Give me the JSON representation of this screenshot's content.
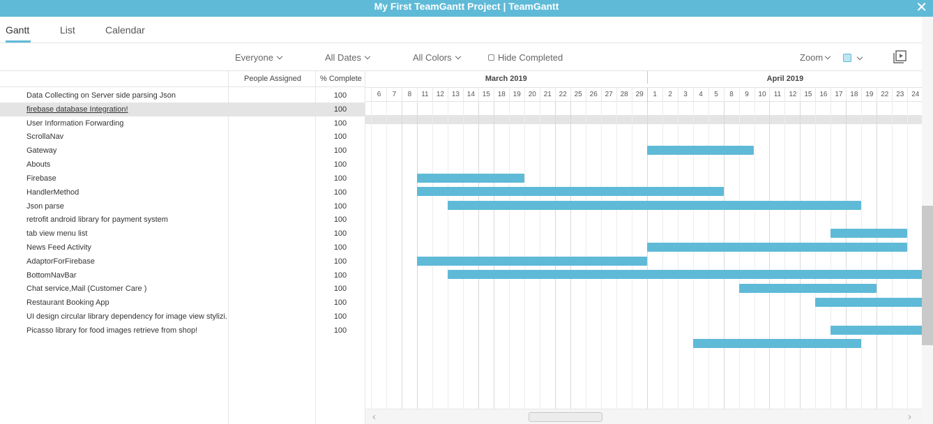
{
  "window": {
    "title": "My First TeamGantt Project | TeamGantt"
  },
  "tabs": [
    {
      "label": "Gantt"
    },
    {
      "label": "List"
    },
    {
      "label": "Calendar"
    }
  ],
  "filters": {
    "people": "Everyone",
    "dates": "All Dates",
    "colors": "All Colors",
    "hide_completed": "Hide Completed",
    "zoom": "Zoom"
  },
  "columns": {
    "assigned": "People Assigned",
    "complete": "% Complete"
  },
  "months": [
    "March 2019",
    "April 2019"
  ],
  "days": [
    "6",
    "7",
    "8",
    "11",
    "12",
    "13",
    "14",
    "15",
    "18",
    "19",
    "20",
    "21",
    "22",
    "25",
    "26",
    "27",
    "28",
    "29",
    "1",
    "2",
    "3",
    "4",
    "5",
    "8",
    "9",
    "10",
    "11",
    "12",
    "15",
    "16",
    "17",
    "18",
    "19",
    "22",
    "23",
    "24"
  ],
  "tasks": [
    {
      "name": "Data Collecting on Server side parsing Json",
      "pct": "100"
    },
    {
      "name": "firebase database Integration!",
      "pct": "100"
    },
    {
      "name": "User Information Forwarding",
      "pct": "100"
    },
    {
      "name": "ScrollaNav",
      "pct": "100"
    },
    {
      "name": "Gateway",
      "pct": "100"
    },
    {
      "name": "Abouts",
      "pct": "100"
    },
    {
      "name": "Firebase",
      "pct": "100"
    },
    {
      "name": "HandlerMethod",
      "pct": "100"
    },
    {
      "name": "Json parse",
      "pct": "100"
    },
    {
      "name": "retrofit android library for payment system",
      "pct": "100"
    },
    {
      "name": "tab view menu list",
      "pct": "100"
    },
    {
      "name": "News Feed Activity",
      "pct": "100"
    },
    {
      "name": "AdaptorForFirebase",
      "pct": "100"
    },
    {
      "name": "BottomNavBar",
      "pct": "100"
    },
    {
      "name": "Chat service,Mail (Customer Care )",
      "pct": "100"
    },
    {
      "name": "Restaurant Booking App",
      "pct": "100"
    },
    {
      "name": "UI design circular library dependency for image view stylizi...",
      "pct": "100"
    },
    {
      "name": "Picasso library for food images retrieve from shop!",
      "pct": "100"
    }
  ],
  "bars": [
    {
      "task": 3,
      "start": "2019-04-01",
      "end": "2019-04-09"
    },
    {
      "task": 5,
      "start": "2019-03-11",
      "end": "2019-03-19"
    },
    {
      "task": 6,
      "start": "2019-03-11",
      "end": "2019-04-05"
    },
    {
      "task": 7,
      "start": "2019-03-13",
      "end": "2019-04-18"
    },
    {
      "task": 9,
      "start": "2019-04-17",
      "end": "2019-04-23"
    },
    {
      "task": 10,
      "start": "2019-04-01",
      "end": "2019-04-23"
    },
    {
      "task": 11,
      "start": "2019-03-11",
      "end": "2019-03-29"
    },
    {
      "task": 12,
      "start": "2019-03-13",
      "end": "2019-04-24"
    },
    {
      "task": 13,
      "start": "2019-04-09",
      "end": "2019-04-19"
    },
    {
      "task": 14,
      "start": "2019-04-16",
      "end": "2019-04-24"
    },
    {
      "task": 16,
      "start": "2019-04-17",
      "end": "2019-04-24"
    },
    {
      "task": 17,
      "start": "2019-04-04",
      "end": "2019-04-18"
    }
  ],
  "selected_task": 1,
  "colors": {
    "accent": "#5fbad7"
  }
}
